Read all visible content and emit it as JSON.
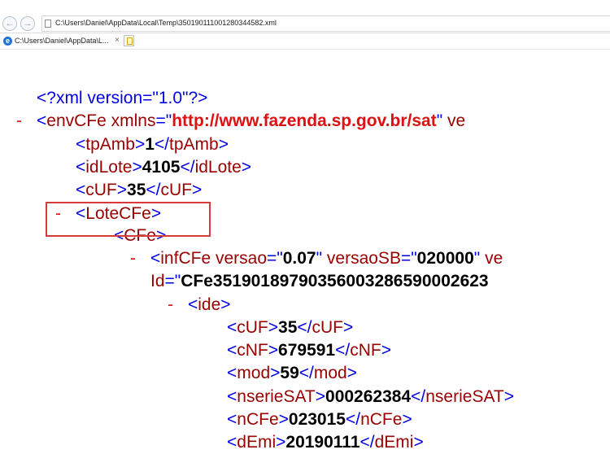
{
  "address_bar": {
    "url": "C:\\Users\\Daniel\\AppData\\Local\\Temp\\350190111001280344582.xml",
    "back_label": "←",
    "forward_label": "→"
  },
  "tab": {
    "title": "C:\\Users\\Daniel\\AppData\\L...",
    "close_label": "×",
    "favicon": "e"
  },
  "xml": {
    "declaration": "<?xml version=\"1.0\"?>",
    "collapse_symbol": "-",
    "envcfe_name": "envCFe",
    "envcfe_attr": "xmlns",
    "envcfe_attr_value": "http://www.fazenda.sp.gov.br/sat",
    "envcfe_tail": "ve",
    "tpAmb": {
      "name": "tpAmb",
      "value": "1"
    },
    "idLote": {
      "name": "idLote",
      "value": "4105"
    },
    "cUF": {
      "name": "cUF",
      "value": "35"
    },
    "lotecfe_name": "LoteCFe",
    "cfe_name": "CFe",
    "infcfe_name": "infCFe",
    "infcfe_attr1": "versao",
    "infcfe_attr1_value": "0.07",
    "infcfe_attr2": "versaoSB",
    "infcfe_attr2_value": "020000",
    "infcfe_tail": "ve",
    "infcfe_id_attr": "Id",
    "infcfe_id_value": "CFe35190189790356003286590002623",
    "ide_name": "ide",
    "ide_cUF": {
      "name": "cUF",
      "value": "35"
    },
    "cNF": {
      "name": "cNF",
      "value": "679591"
    },
    "mod": {
      "name": "mod",
      "value": "59"
    },
    "nserieSAT": {
      "name": "nserieSAT",
      "value": "000262384"
    },
    "nCFe": {
      "name": "nCFe",
      "value": "023015"
    },
    "dEmi": {
      "name": "dEmi",
      "value": "20190111"
    }
  }
}
